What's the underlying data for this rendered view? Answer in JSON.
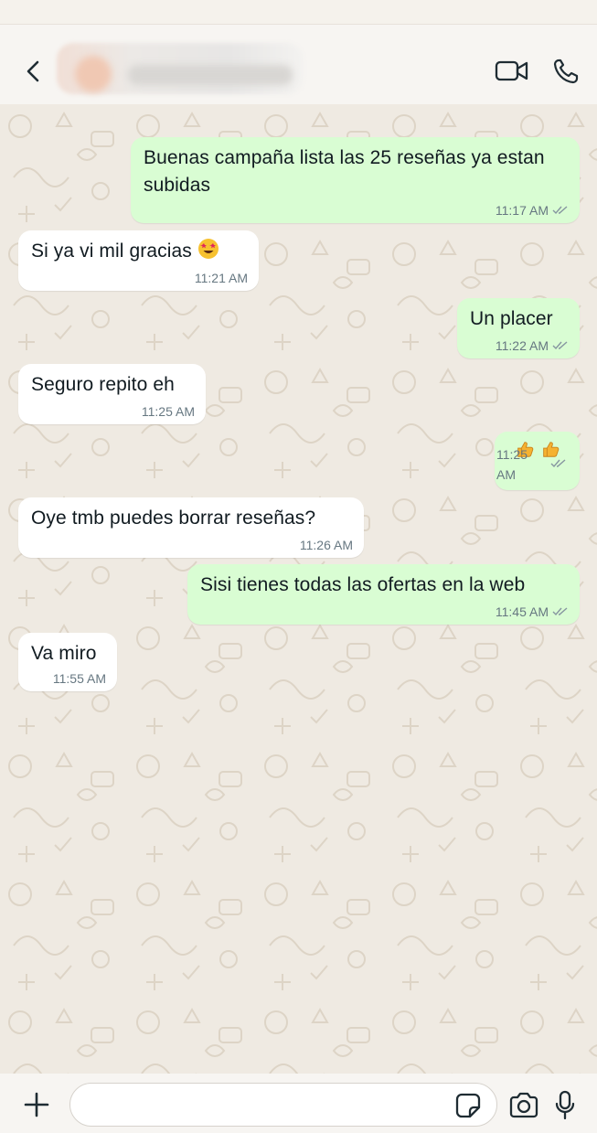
{
  "header": {
    "contact_name": "",
    "icons": {
      "back": "chevron-left-icon",
      "video": "video-camera-icon",
      "phone": "phone-icon"
    }
  },
  "messages": [
    {
      "direction": "out",
      "text": "Buenas campaña lista las 25 reseñas ya estan subidas",
      "time": "11:17 AM",
      "status": "read"
    },
    {
      "direction": "in",
      "text": "Si ya vi mil gracias",
      "emoji": "star-struck-emoji",
      "time": "11:21 AM"
    },
    {
      "direction": "out",
      "text": "Un placer",
      "time": "11:22 AM",
      "status": "read"
    },
    {
      "direction": "in",
      "text": "Seguro repito eh",
      "time": "11:25 AM"
    },
    {
      "direction": "out",
      "text": "",
      "emoji": "thumbs-up-emoji x2",
      "time": "11:25 AM",
      "status": "read"
    },
    {
      "direction": "in",
      "text": "Oye tmb puedes borrar reseñas?",
      "time": "11:26 AM"
    },
    {
      "direction": "out",
      "text": "Sisi tienes todas las ofertas en la web",
      "time": "11:45 AM",
      "status": "read"
    },
    {
      "direction": "in",
      "text": "Va miro",
      "time": "11:55 AM"
    }
  ],
  "input_bar": {
    "placeholder": "",
    "icons": {
      "attach": "plus-icon",
      "sticker": "sticker-icon",
      "camera": "camera-icon",
      "mic": "microphone-icon"
    }
  },
  "colors": {
    "chat_background": "#efeae2",
    "outgoing_bubble": "#d9fdd3",
    "incoming_bubble": "#ffffff",
    "meta_text": "#667781",
    "read_ticks": "#8696a0"
  }
}
